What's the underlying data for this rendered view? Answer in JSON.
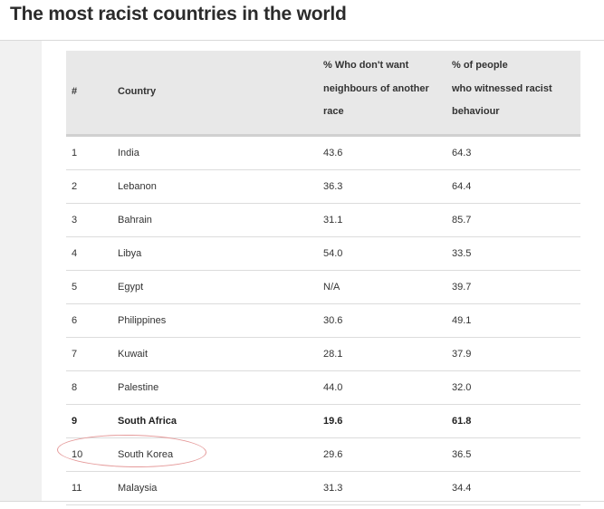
{
  "title": "The most racist countries in the world",
  "table": {
    "headers": {
      "rank": "#",
      "country": "Country",
      "neighbours": [
        "% Who don't want",
        "neighbours of another",
        "race"
      ],
      "witnessed": [
        "% of people",
        "who witnessed racist",
        "behaviour"
      ]
    },
    "rows": [
      {
        "rank": "1",
        "country": "India",
        "neighbours": "43.6",
        "witnessed": "64.3"
      },
      {
        "rank": "2",
        "country": "Lebanon",
        "neighbours": "36.3",
        "witnessed": "64.4"
      },
      {
        "rank": "3",
        "country": "Bahrain",
        "neighbours": "31.1",
        "witnessed": "85.7"
      },
      {
        "rank": "4",
        "country": "Libya",
        "neighbours": "54.0",
        "witnessed": "33.5"
      },
      {
        "rank": "5",
        "country": "Egypt",
        "neighbours": "N/A",
        "witnessed": "39.7"
      },
      {
        "rank": "6",
        "country": "Philippines",
        "neighbours": "30.6",
        "witnessed": "49.1"
      },
      {
        "rank": "7",
        "country": "Kuwait",
        "neighbours": "28.1",
        "witnessed": "37.9"
      },
      {
        "rank": "8",
        "country": "Palestine",
        "neighbours": "44.0",
        "witnessed": "32.0"
      },
      {
        "rank": "9",
        "country": "South Africa",
        "neighbours": "19.6",
        "witnessed": "61.8",
        "bold": true
      },
      {
        "rank": "10",
        "country": "South Korea",
        "neighbours": "29.6",
        "witnessed": "36.5",
        "circled": true
      },
      {
        "rank": "11",
        "country": "Malaysia",
        "neighbours": "31.3",
        "witnessed": "34.4"
      }
    ]
  },
  "annotation": {
    "circle_color": "#e59a9a",
    "circled_row": "10"
  }
}
